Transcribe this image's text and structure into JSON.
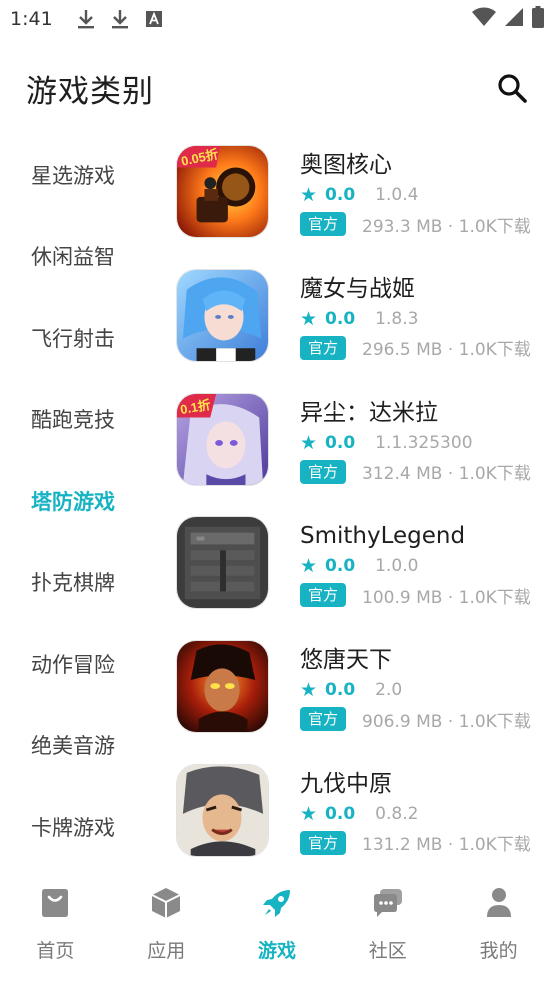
{
  "status_bar": {
    "time": "1:41"
  },
  "header": {
    "title": "游戏类别"
  },
  "categories": [
    {
      "label": "星选游戏",
      "active": false
    },
    {
      "label": "休闲益智",
      "active": false
    },
    {
      "label": "飞行射击",
      "active": false
    },
    {
      "label": "酷跑竞技",
      "active": false
    },
    {
      "label": "塔防游戏",
      "active": true
    },
    {
      "label": "扑克棋牌",
      "active": false
    },
    {
      "label": "动作冒险",
      "active": false
    },
    {
      "label": "绝美音游",
      "active": false
    },
    {
      "label": "卡牌游戏",
      "active": false
    }
  ],
  "games": [
    {
      "name": "奥图核心",
      "score": "0.0",
      "version": "1.0.4",
      "badge": "官方",
      "meta": "293.3 MB · 1.0K下载",
      "icon": "ottocore-icon"
    },
    {
      "name": "魔女与战姬",
      "score": "0.0",
      "version": "1.8.3",
      "badge": "官方",
      "meta": "296.5 MB · 1.0K下载",
      "icon": "witch-icon"
    },
    {
      "name": "异尘：达米拉",
      "score": "0.0",
      "version": "1.1.325300",
      "badge": "官方",
      "meta": "312.4 MB · 1.0K下载",
      "icon": "damira-icon"
    },
    {
      "name": "SmithyLegend",
      "score": "0.0",
      "version": "1.0.0",
      "badge": "官方",
      "meta": "100.9 MB · 1.0K下载",
      "icon": "smithy-icon"
    },
    {
      "name": "悠唐天下",
      "score": "0.0",
      "version": "2.0",
      "badge": "官方",
      "meta": "906.9 MB · 1.0K下载",
      "icon": "youtang-icon"
    },
    {
      "name": "九伐中原",
      "score": "0.0",
      "version": "0.8.2",
      "badge": "官方",
      "meta": "131.2 MB · 1.0K下载",
      "icon": "jiufa-icon"
    }
  ],
  "icon_badges": {
    "game1": "0.05折",
    "game3": "0.1折"
  },
  "bottom_nav": [
    {
      "label": "首页",
      "icon": "home-bag-icon",
      "active": false
    },
    {
      "label": "应用",
      "icon": "cube-icon",
      "active": false
    },
    {
      "label": "游戏",
      "icon": "rocket-icon",
      "active": true
    },
    {
      "label": "社区",
      "icon": "chat-icon",
      "active": false
    },
    {
      "label": "我的",
      "icon": "person-icon",
      "active": false
    }
  ],
  "colors": {
    "accent": "#17b3c3",
    "accent_bg": "#e7f6f8",
    "muted": "#a8a8a8"
  }
}
